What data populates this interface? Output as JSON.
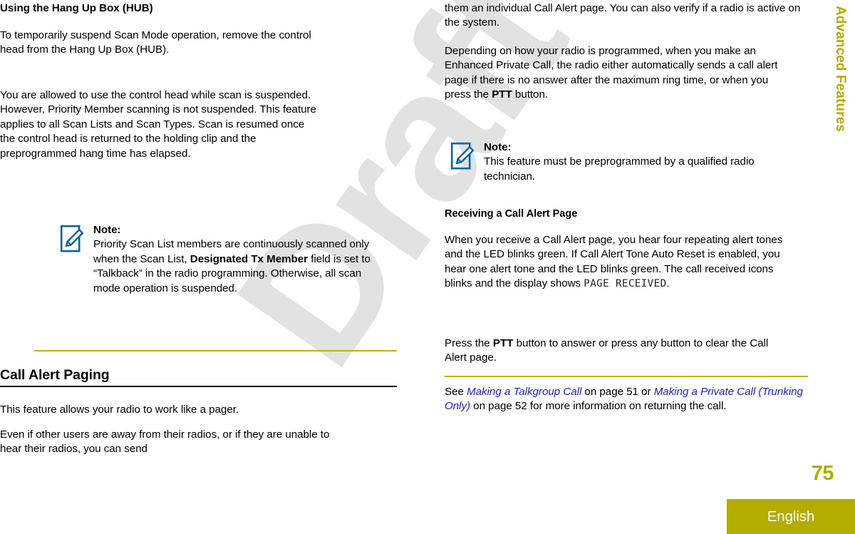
{
  "document": {
    "side_tab_label": "Advanced Features",
    "page_number": "75",
    "language": "English",
    "watermark": "Draft"
  },
  "colors": {
    "olive": "#b3ad00",
    "olive_rule": "#b8b800",
    "note_icon_blue": "#0a64a8",
    "xref_blue": "#1c1cf0",
    "watermark_gray": "#e2e2e2",
    "text_black": "#000000"
  },
  "left_column": {
    "heading": "Using the Hang Up Box (HUB)",
    "paragraphs": [
      "To temporarily suspend Scan Mode operation, remove the control head from the Hang Up Box (HUB).",
      "You are allowed to use the control head while scan is suspended. However, Priority Member scanning is not suspended. This feature applies to all Scan Lists and Scan Types. Scan is resumed once the control head is returned to the holding clip and the preprogrammed hang time has elapsed."
    ],
    "note": {
      "icon": "note-pencil-icon",
      "label": "Note:",
      "text_before_bold": "Priority Scan List members are continuously scanned only when the Scan List, ",
      "bold": "Designated Tx Member",
      "text_after_bold": " field is set to “Talkback” in the radio programming. Otherwise, all scan mode operation is suspended."
    },
    "section_heading": "Call Alert Paging",
    "section_paragraphs": [
      "This feature allows your radio to work like a pager.",
      "Even if other users are away from their radios, or if they are unable to hear their radios, you can send"
    ]
  },
  "right_column": {
    "continued_paragraph": "them an individual Call Alert page. You can also verify if a radio is active on the system.",
    "paragraph_2_parts": {
      "before_bold": "Depending on how your radio is programmed, when you make an Enhanced Private Call, the radio either automatically sends a call alert page if there is no answer after the maximum ring time, or when you press the ",
      "bold": "PTT",
      "after_bold": " button."
    },
    "note": {
      "icon": "note-pencil-icon",
      "label": "Note:",
      "text": "This feature must be preprogrammed by a qualified radio technician."
    },
    "subheading": "Receiving a Call Alert Page",
    "paragraph_3_parts": {
      "before_mono": "When you receive a Call Alert page, you hear four repeating alert tones and the LED blinks green. If Call Alert Tone Auto Reset is enabled, you hear one alert tone and the LED blinks green. The call received icons blinks and the display shows ",
      "mono": "PAGE RECEIVED",
      "after_mono": "."
    },
    "paragraph_4_parts": {
      "before_bold": "Press the ",
      "bold": "PTT",
      "after_bold": " button to answer or press any button to clear the Call Alert page."
    },
    "see_also": {
      "prefix": "See ",
      "link1": "Making a Talkgroup Call",
      "mid1": " on page 51 or ",
      "link2": "Making a Private Call (Trunking Only)",
      "mid2": " on page 52 for more information on returning the call."
    }
  }
}
